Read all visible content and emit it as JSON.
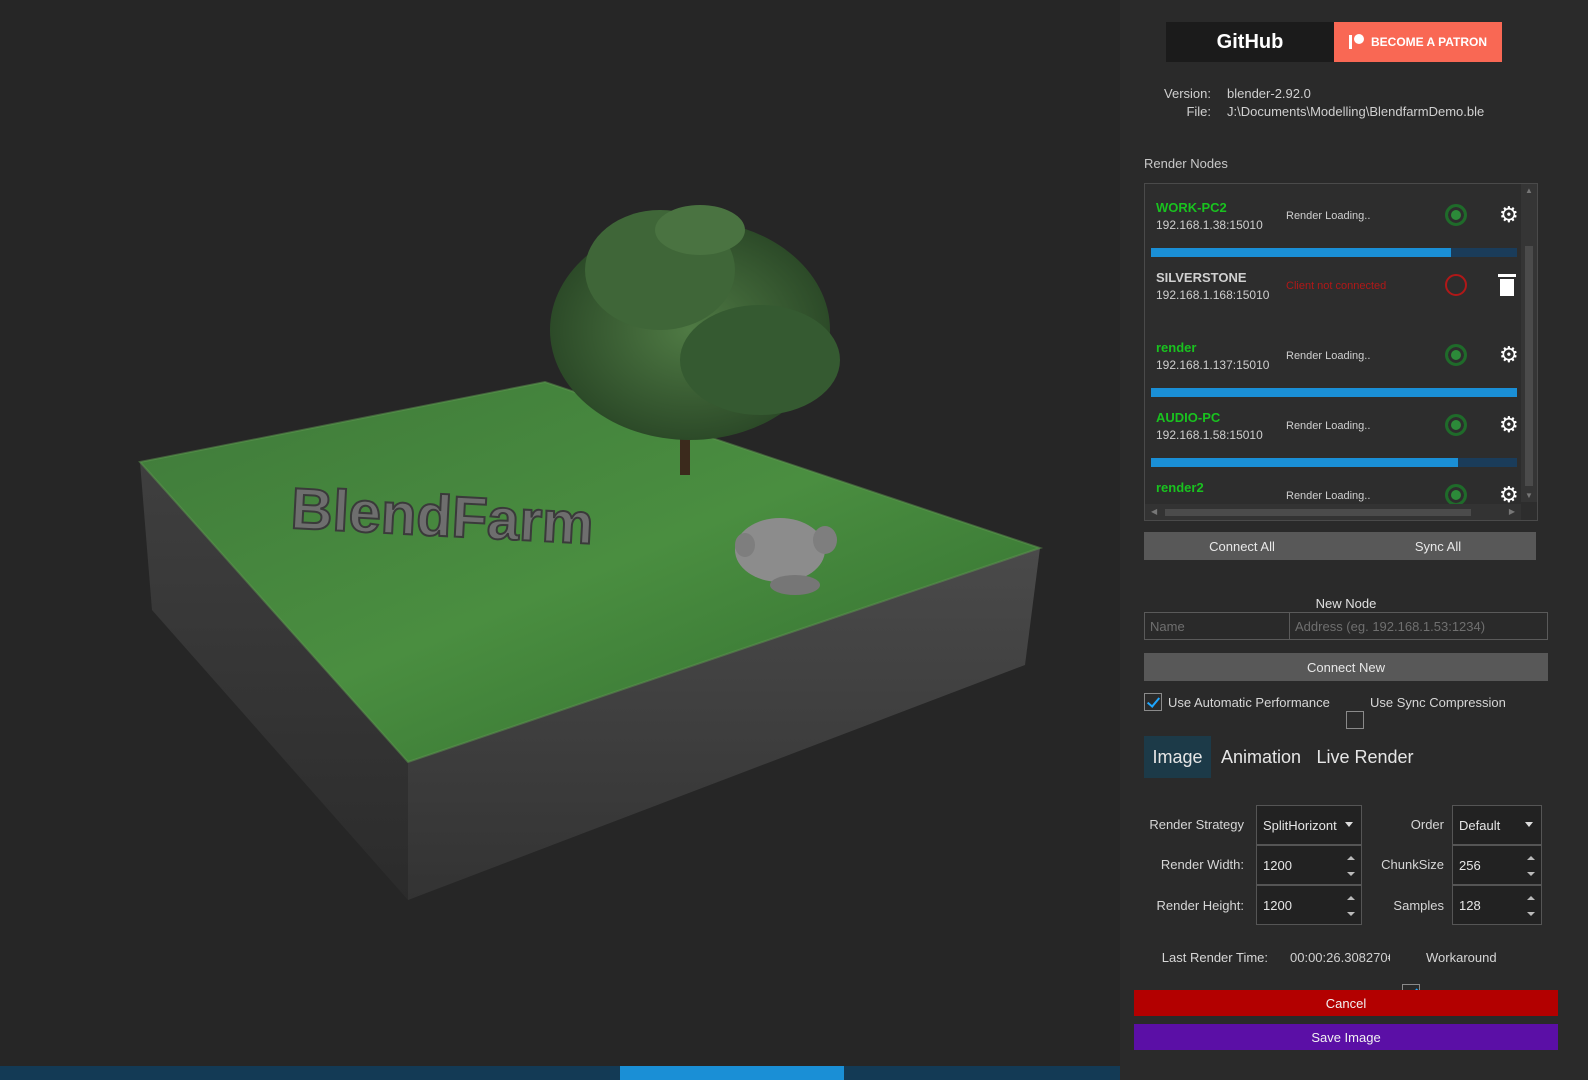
{
  "links": {
    "github_label": "GitHub",
    "patron_label": "BECOME A PATRON"
  },
  "info": {
    "version_label": "Version:",
    "version_value": "blender-2.92.0",
    "file_label": "File:",
    "file_value": "J:\\Documents\\Modelling\\BlendfarmDemo.ble"
  },
  "render_nodes": {
    "title": "Render Nodes",
    "nodes": [
      {
        "name": "WORK-PC2",
        "address": "192.168.1.38:15010",
        "status": "Render Loading..",
        "connected": true,
        "name_color": "#19c21f",
        "progress": 0.82
      },
      {
        "name": "SILVERSTONE",
        "address": "192.168.1.168:15010",
        "status": "Client not connected",
        "connected": false,
        "name_color": "#d0d0d0"
      },
      {
        "name": "render",
        "address": "192.168.1.137:15010",
        "status": "Render Loading..",
        "connected": true,
        "name_color": "#19c21f",
        "progress": 1.0
      },
      {
        "name": "AUDIO-PC",
        "address": "192.168.1.58:15010",
        "status": "Render Loading..",
        "connected": true,
        "name_color": "#19c21f",
        "progress": 0.84
      },
      {
        "name": "render2",
        "address": "",
        "status": "Render Loading..",
        "connected": true,
        "name_color": "#19c21f"
      }
    ],
    "connect_all_label": "Connect All",
    "sync_all_label": "Sync All"
  },
  "new_node": {
    "title": "New Node",
    "name_placeholder": "Name",
    "address_placeholder": "Address (eg. 192.168.1.53:1234)",
    "connect_new_label": "Connect New"
  },
  "options": {
    "auto_perf_label": "Use Automatic Performance",
    "auto_perf_checked": true,
    "sync_comp_label": "Use Sync Compression",
    "sync_comp_checked": false
  },
  "tabs": [
    {
      "label": "Image",
      "active": true
    },
    {
      "label": "Animation",
      "active": false
    },
    {
      "label": "Live Render",
      "active": false
    }
  ],
  "settings": {
    "render_strategy_label": "Render Strategy",
    "render_strategy_value": "SplitHorizont",
    "order_label": "Order",
    "order_value": "Default",
    "render_width_label": "Render Width:",
    "render_width_value": "1200",
    "chunk_size_label": "ChunkSize",
    "chunk_size_value": "256",
    "render_height_label": "Render Height:",
    "render_height_value": "1200",
    "samples_label": "Samples",
    "samples_value": "128",
    "last_render_label": "Last Render Time:",
    "last_render_value": "00:00:26.308270€",
    "workaround_label": "Workaround",
    "workaround_checked": true
  },
  "actions": {
    "cancel_label": "Cancel",
    "save_label": "Save Image"
  },
  "preview": {
    "logo_text": "BlendFarm",
    "render_progress": 0.2
  },
  "colors": {
    "accent": "#1a8fd6",
    "cancel": "#b30000",
    "save": "#5b0fa6",
    "patron": "#f96854",
    "online": "#19c21f",
    "offline": "#b01818"
  }
}
